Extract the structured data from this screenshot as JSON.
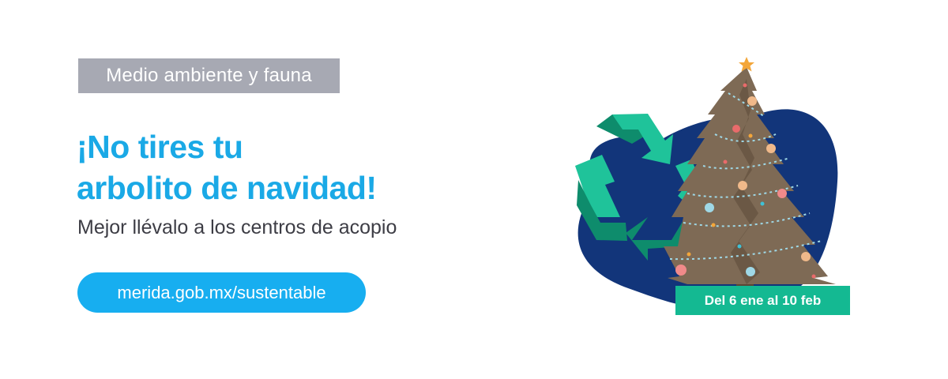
{
  "category": {
    "label": "Medio ambiente y fauna"
  },
  "headline": {
    "line1": "¡No tires tu",
    "line2": "arbolito de navidad!"
  },
  "subtitle": "Mejor llévalo a los centros de acopio",
  "link": {
    "label": "merida.gob.mx/sustentable"
  },
  "badge": {
    "label": "Del 6 ene al 10 feb"
  },
  "illustration": {
    "icons": [
      "recycle-icon",
      "christmas-tree-icon",
      "star-icon"
    ],
    "colors": {
      "blob": "#12357a",
      "recycle_light": "#1fc39a",
      "recycle_dark": "#0e8c6c",
      "tree": "#7e6a55",
      "star": "#f3a63a"
    }
  },
  "colors": {
    "headline": "#1aa9e6",
    "tag_bg": "#a7a9b3",
    "pill_bg": "#17aef0",
    "badge_bg": "#14b992"
  }
}
